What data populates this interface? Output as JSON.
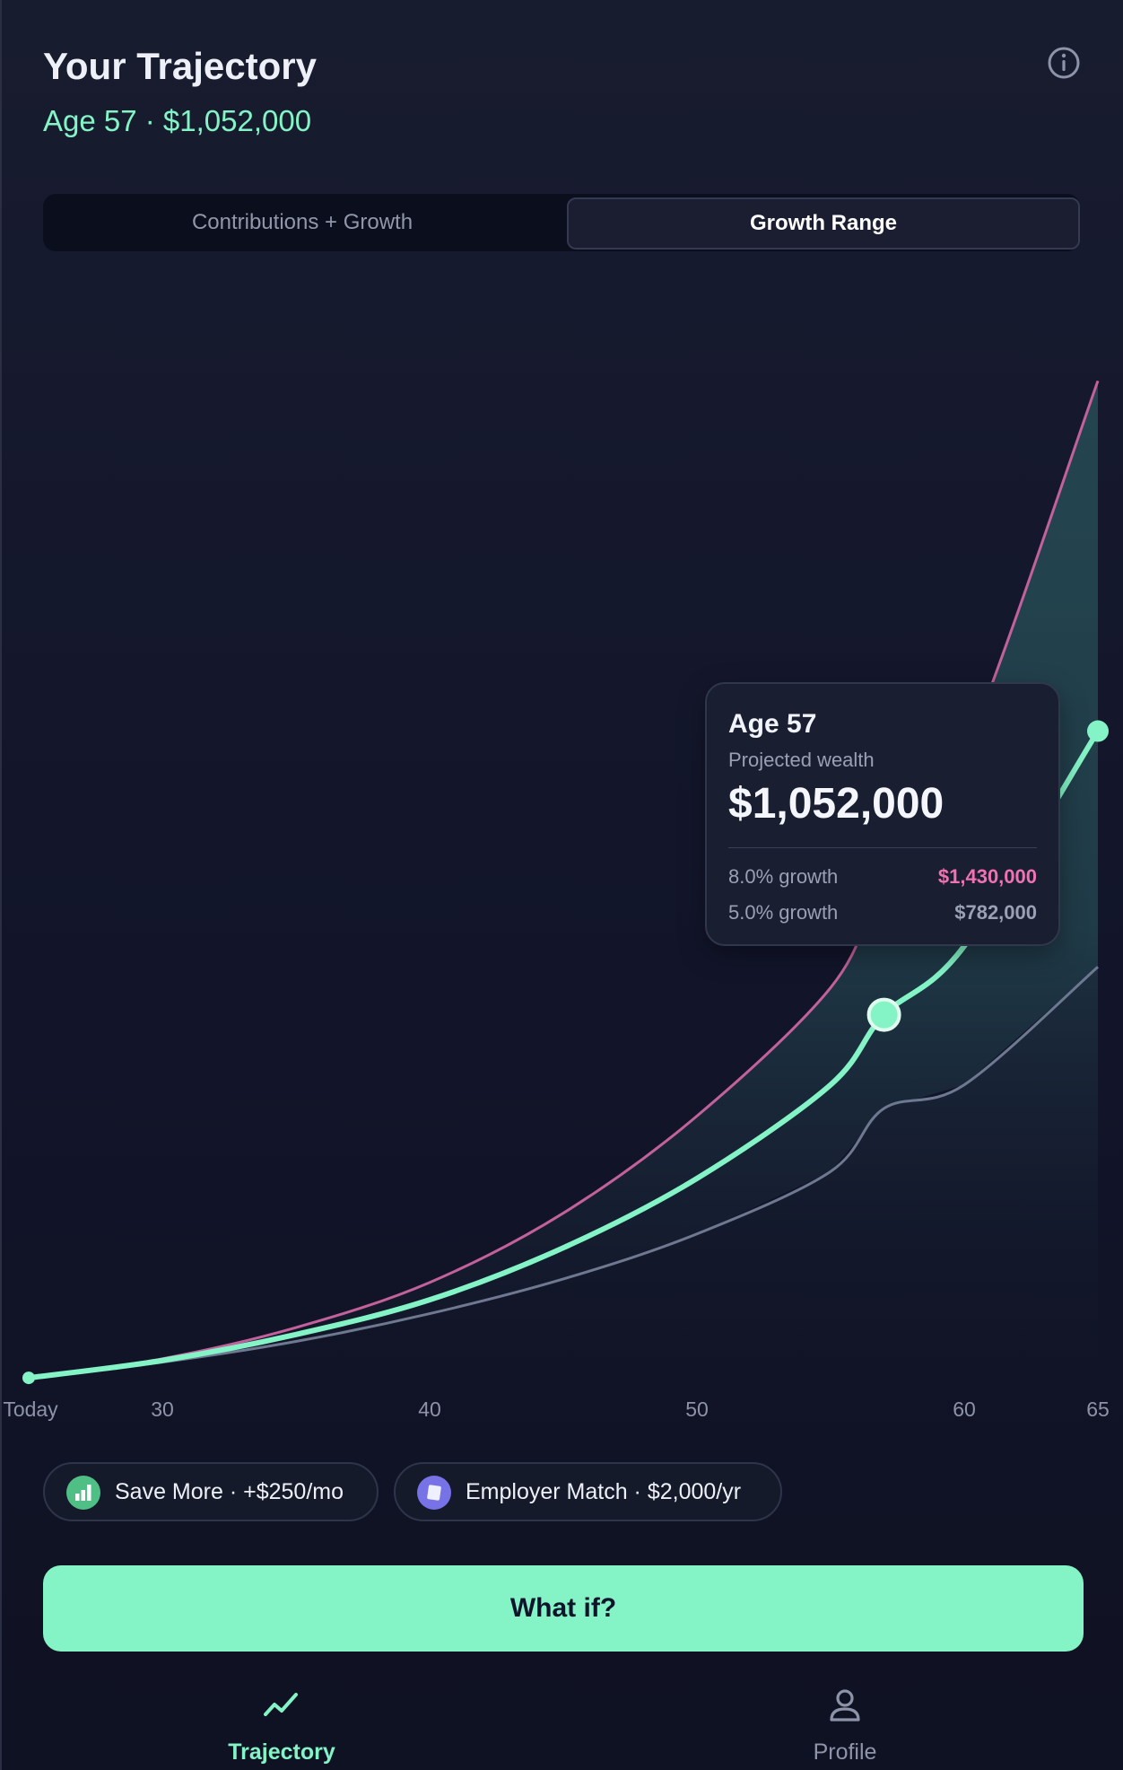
{
  "header": {
    "title": "Your Trajectory",
    "subtitle": "Age 57 · $1,052,000"
  },
  "icons": {
    "info": "info-icon",
    "trajectory": "trend-line-icon",
    "profile": "person-icon"
  },
  "tabs": [
    {
      "label": "Contributions + Growth",
      "active": false
    },
    {
      "label": "Growth Range",
      "active": true
    }
  ],
  "chart_data": {
    "type": "area",
    "x_label_ticks": [
      "Today",
      "30",
      "40",
      "50",
      "60",
      "65"
    ],
    "x_ages": [
      25,
      30,
      35,
      40,
      45,
      50,
      55,
      57,
      60,
      65
    ],
    "series": [
      {
        "name": "8.0% growth",
        "color": "#c2619b",
        "values": [
          5000,
          60000,
          150000,
          280000,
          480000,
          760000,
          1130000,
          1430000,
          1800000,
          2880000
        ]
      },
      {
        "color": "#84f4c7",
        "values": [
          5000,
          55000,
          130000,
          230000,
          380000,
          580000,
          850000,
          1052000,
          1250000,
          1870000
        ]
      },
      {
        "name": "5.0% growth",
        "color": "#6e7890",
        "values": [
          5000,
          50000,
          110000,
          190000,
          290000,
          420000,
          600000,
          782000,
          850000,
          1190000
        ]
      }
    ],
    "highlight": {
      "age": 57,
      "value": 1052000
    },
    "ylim": [
      0,
      3000000
    ]
  },
  "tooltip": {
    "age": "Age 57",
    "label": "Projected wealth",
    "value": "$1,052,000",
    "rows": [
      {
        "label": "8.0% growth",
        "value": "$1,430,000"
      },
      {
        "label": "5.0% growth",
        "value": "$782,000"
      }
    ]
  },
  "chips": [
    {
      "label": "Save More · +$250/mo",
      "icon": "bar-chart-icon",
      "color": "#4fbf86"
    },
    {
      "label": "Employer Match · $2,000/yr",
      "icon": "square-icon",
      "color": "#7772e6"
    }
  ],
  "cta": {
    "label": "What if?"
  },
  "nav": [
    {
      "label": "Trajectory",
      "active": true
    },
    {
      "label": "Profile",
      "active": false
    }
  ]
}
